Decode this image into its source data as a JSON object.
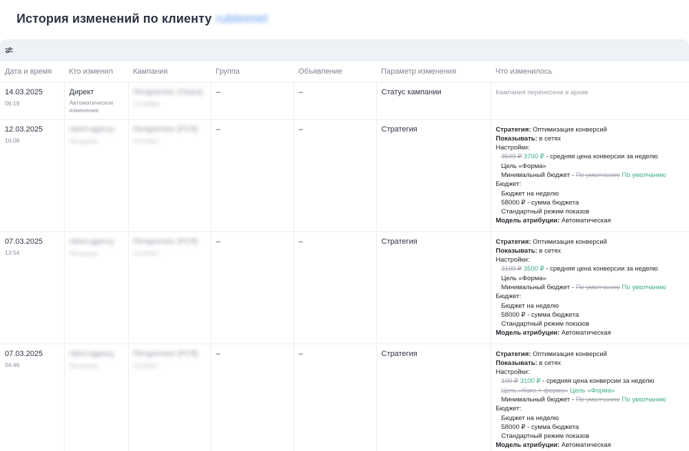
{
  "page": {
    "title": "История изменений  по клиенту",
    "client_name": "rubleimet"
  },
  "toolbar": {
    "filter_icon": "sliders-icon"
  },
  "table": {
    "headers": [
      "Дата и время",
      "Кто изменил",
      "Кампания",
      "Группа",
      "Объявление",
      "Параметр изменения",
      "Что изменилось"
    ],
    "rows": [
      {
        "date": "14.03.2025",
        "time": "06:19",
        "who": "Директ",
        "who_sub": "Автоматическое изменение",
        "campaign": "Ретаргетинг (Поиск)",
        "campaign_id": "#1222888",
        "group": "–",
        "ad": "–",
        "param": "Статус кампании",
        "change_text": "Кампания перенесена в архив"
      },
      {
        "date": "12.03.2025",
        "time": "16:08",
        "who": "client-agency",
        "who_sub": "Менеджер",
        "campaign": "Ретаргетинг (РСЯ)",
        "campaign_id": "#1193807",
        "group": "–",
        "ad": "–",
        "param": "Стратегия",
        "changes": {
          "strategy_label": "Стратегия:",
          "strategy": "Оптимизация конверсий",
          "show_label": "Показывать:",
          "show": "в сетях",
          "settings_label": "Настройки:",
          "price_old": "3500 ₽",
          "price_new": "3700 ₽",
          "price_rest": "- средняя цена конверсии за неделю",
          "goal": "Цель «Форма»",
          "minbudget_label": "Минимальный бюджет -",
          "minbudget_old": "По умолчанию",
          "minbudget_new": "По умолчанию",
          "budget_label": "Бюджет:",
          "budget_week": "Бюджет на неделю",
          "budget_sum": "58000 ₽ - сумма бюджета",
          "budget_mode": "Стандартный режим показов",
          "attr_label": "Модель атрибуции:",
          "attr": "Автоматическая"
        }
      },
      {
        "date": "07.03.2025",
        "time": "13:54",
        "who": "client-agency",
        "who_sub": "Менеджер",
        "campaign": "Ретаргетинг (РСЯ)",
        "campaign_id": "#1193807",
        "group": "–",
        "ad": "–",
        "param": "Стратегия",
        "changes": {
          "strategy_label": "Стратегия:",
          "strategy": "Оптимизация конверсий",
          "show_label": "Показывать:",
          "show": "в сетях",
          "settings_label": "Настройки:",
          "price_old": "3100 ₽",
          "price_new": "3500 ₽",
          "price_rest": "- средняя цена конверсии за неделю",
          "goal": "Цель «Форма»",
          "minbudget_label": "Минимальный бюджет -",
          "minbudget_old": "По умолчанию",
          "minbudget_new": "По умолчанию",
          "budget_label": "Бюджет:",
          "budget_week": "Бюджет на неделю",
          "budget_sum": "58000 ₽ - сумма бюджета",
          "budget_mode": "Стандартный режим показов",
          "attr_label": "Модель атрибуции:",
          "attr": "Автоматическая"
        }
      },
      {
        "date": "07.03.2025",
        "time": "04:46",
        "who": "client-agency",
        "who_sub": "Менеджер",
        "campaign": "Ретаргетинг (РСЯ)",
        "campaign_id": "#1193807",
        "group": "–",
        "ad": "–",
        "param": "Стратегия",
        "changes": {
          "strategy_label": "Стратегия:",
          "strategy": "Оптимизация конверсий",
          "show_label": "Показывать:",
          "show": "в сетях",
          "settings_label": "Настройки:",
          "price_old": "100 ₽",
          "price_new": "3100 ₽",
          "price_rest": "- средняя цена конверсии за неделю",
          "goal_old": "Цель «Квиз + форма»",
          "goal_new": "Цель «Форма»",
          "minbudget_label": "Минимальный бюджет -",
          "minbudget_old": "По умолчанию",
          "minbudget_new": "По умолчанию",
          "budget_label": "Бюджет:",
          "budget_week": "Бюджет на неделю",
          "budget_sum": "58000 ₽ - сумма бюджета",
          "budget_mode": "Стандартный режим показов",
          "attr_label": "Модель атрибуции:",
          "attr": "Автоматическая"
        }
      }
    ]
  }
}
